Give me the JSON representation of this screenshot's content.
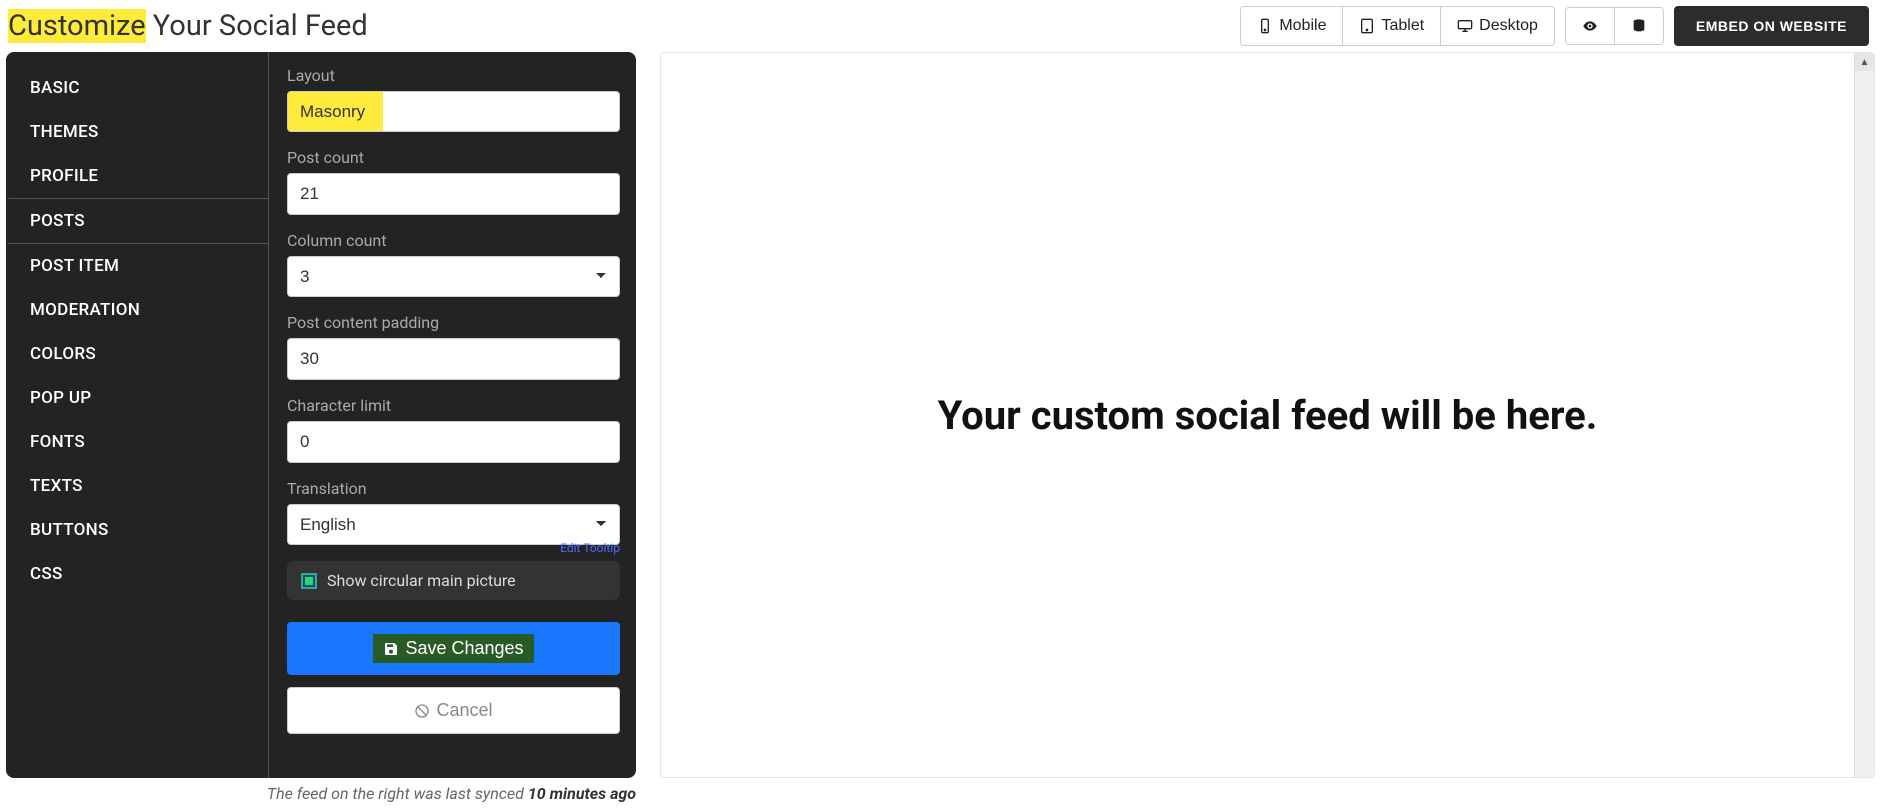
{
  "title": {
    "highlight": "Customize",
    "rest": " Your Social Feed"
  },
  "top": {
    "mobile": "Mobile",
    "tablet": "Tablet",
    "desktop": "Desktop",
    "embed": "EMBED ON WEBSITE"
  },
  "sidebar": {
    "items": [
      {
        "label": "BASIC"
      },
      {
        "label": "THEMES"
      },
      {
        "label": "PROFILE"
      },
      {
        "label": "POSTS",
        "active": true
      },
      {
        "label": "POST ITEM"
      },
      {
        "label": "MODERATION"
      },
      {
        "label": "COLORS"
      },
      {
        "label": "POP UP"
      },
      {
        "label": "FONTS"
      },
      {
        "label": "TEXTS"
      },
      {
        "label": "BUTTONS"
      },
      {
        "label": "CSS"
      }
    ]
  },
  "form": {
    "layout_label": "Layout",
    "layout_value": "Masonry",
    "post_count_label": "Post count",
    "post_count_value": "21",
    "column_count_label": "Column count",
    "column_count_value": "3",
    "padding_label": "Post content padding",
    "padding_value": "30",
    "char_limit_label": "Character limit",
    "char_limit_value": "0",
    "translation_label": "Translation",
    "translation_value": "English",
    "checkbox_label": "Show circular main picture",
    "edit_tooltip": "Edit Tooltip",
    "save": "Save Changes",
    "cancel": "Cancel"
  },
  "preview": {
    "placeholder": "Your custom social feed will be here."
  },
  "sync": {
    "prefix": "The feed on the right was last synced ",
    "time": "10 minutes ago"
  }
}
